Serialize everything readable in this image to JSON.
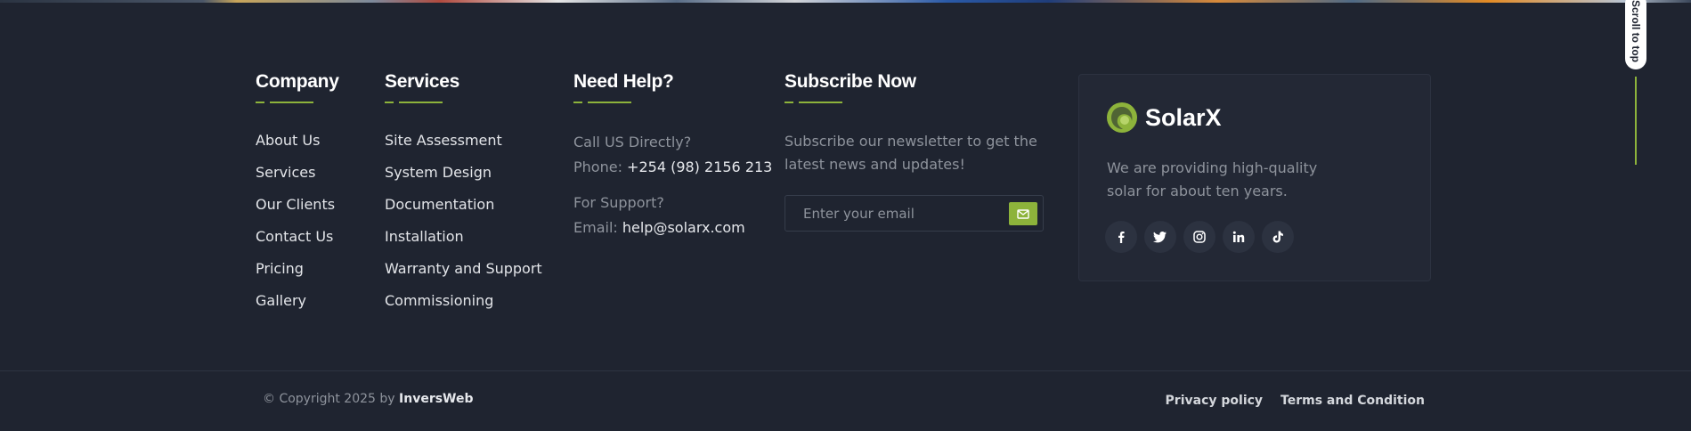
{
  "company": {
    "title": "Company",
    "links": [
      "About Us",
      "Services",
      "Our Clients",
      "Contact Us",
      "Pricing",
      "Gallery"
    ]
  },
  "services": {
    "title": "Services",
    "links": [
      "Site Assessment",
      "System Design",
      "Documentation",
      "Installation",
      "Warranty and Support",
      "Commissioning"
    ]
  },
  "help": {
    "title": "Need Help?",
    "call_label": "Call US Directly?",
    "phone_prefix": "Phone:",
    "phone": "+254 (98) 2156 213",
    "support_label": "For Support?",
    "email_prefix": "Email:",
    "email": "help@solarx.com"
  },
  "subscribe": {
    "title": "Subscribe Now",
    "description": "Subscribe our newsletter to get the latest news and updates!",
    "placeholder": "Enter your email",
    "send_icon": "envelope-icon"
  },
  "brand_card": {
    "name": "SolarX",
    "description": "We are providing high-quality solar for about ten years.",
    "socials": [
      "facebook-icon",
      "twitter-icon",
      "instagram-icon",
      "linkedin-icon",
      "tiktok-icon"
    ]
  },
  "scroll_top": {
    "label": "Scroll to top"
  },
  "bottom": {
    "copyright_prefix": "© Copyright 2025 by",
    "copyright_brand": "InversWeb",
    "privacy": "Privacy policy",
    "terms": "Terms and Condition"
  },
  "colors": {
    "background": "#1f2430",
    "accent": "#8db33b",
    "card": "#232835",
    "muted_text": "#8e939c"
  }
}
